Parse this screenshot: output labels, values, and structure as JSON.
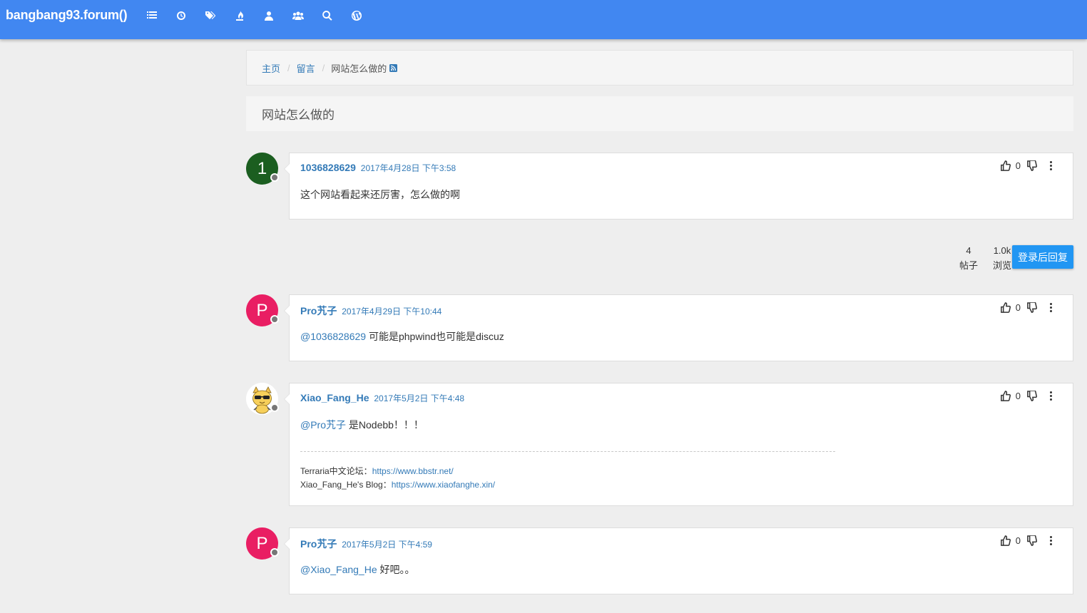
{
  "nav": {
    "brand": "bangbang93.forum()",
    "icons": [
      "list-icon",
      "clock-icon",
      "tags-icon",
      "fire-icon",
      "user-icon",
      "users-icon",
      "search-icon",
      "wordpress-icon"
    ]
  },
  "breadcrumb": {
    "home": "主页",
    "category": "留言",
    "current": "网站怎么做的"
  },
  "topic": {
    "title": "网站怎么做的"
  },
  "posts": [
    {
      "avatar_letter": "1",
      "avatar_color": "#1b5e20",
      "username": "1036828629",
      "timestamp": "2017年4月28日 下午3:58",
      "body": "这个网站看起来还厉害，怎么做的啊",
      "votes": "0"
    },
    {
      "avatar_letter": "P",
      "avatar_color": "#e91e63",
      "username": "Pro艽子",
      "timestamp": "2017年4月29日 下午10:44",
      "mention": "@1036828629",
      "body": " 可能是phpwind也可能是discuz",
      "votes": "0"
    },
    {
      "avatar_letter": "",
      "avatar_color": "#ffffff",
      "username": "Xiao_Fang_He",
      "timestamp": "2017年5月2日 下午4:48",
      "mention": "@Pro艽子",
      "body": " 是Nodebb！！！",
      "votes": "0",
      "signature": {
        "line1_label": "Terraria中文论坛：",
        "line1_link": "https://www.bbstr.net/",
        "line2_label": "Xiao_Fang_He's Blog：",
        "line2_link": "https://www.xiaofanghe.xin/"
      }
    },
    {
      "avatar_letter": "P",
      "avatar_color": "#e91e63",
      "username": "Pro艽子",
      "timestamp": "2017年5月2日 下午4:59",
      "mention": "@Xiao_Fang_He",
      "body": " 好吧。。",
      "votes": "0"
    }
  ],
  "stats": {
    "posts_count": "4",
    "posts_label": "帖子",
    "views_count": "1.0k",
    "views_label": "浏览"
  },
  "reply_button": "登录后回复"
}
